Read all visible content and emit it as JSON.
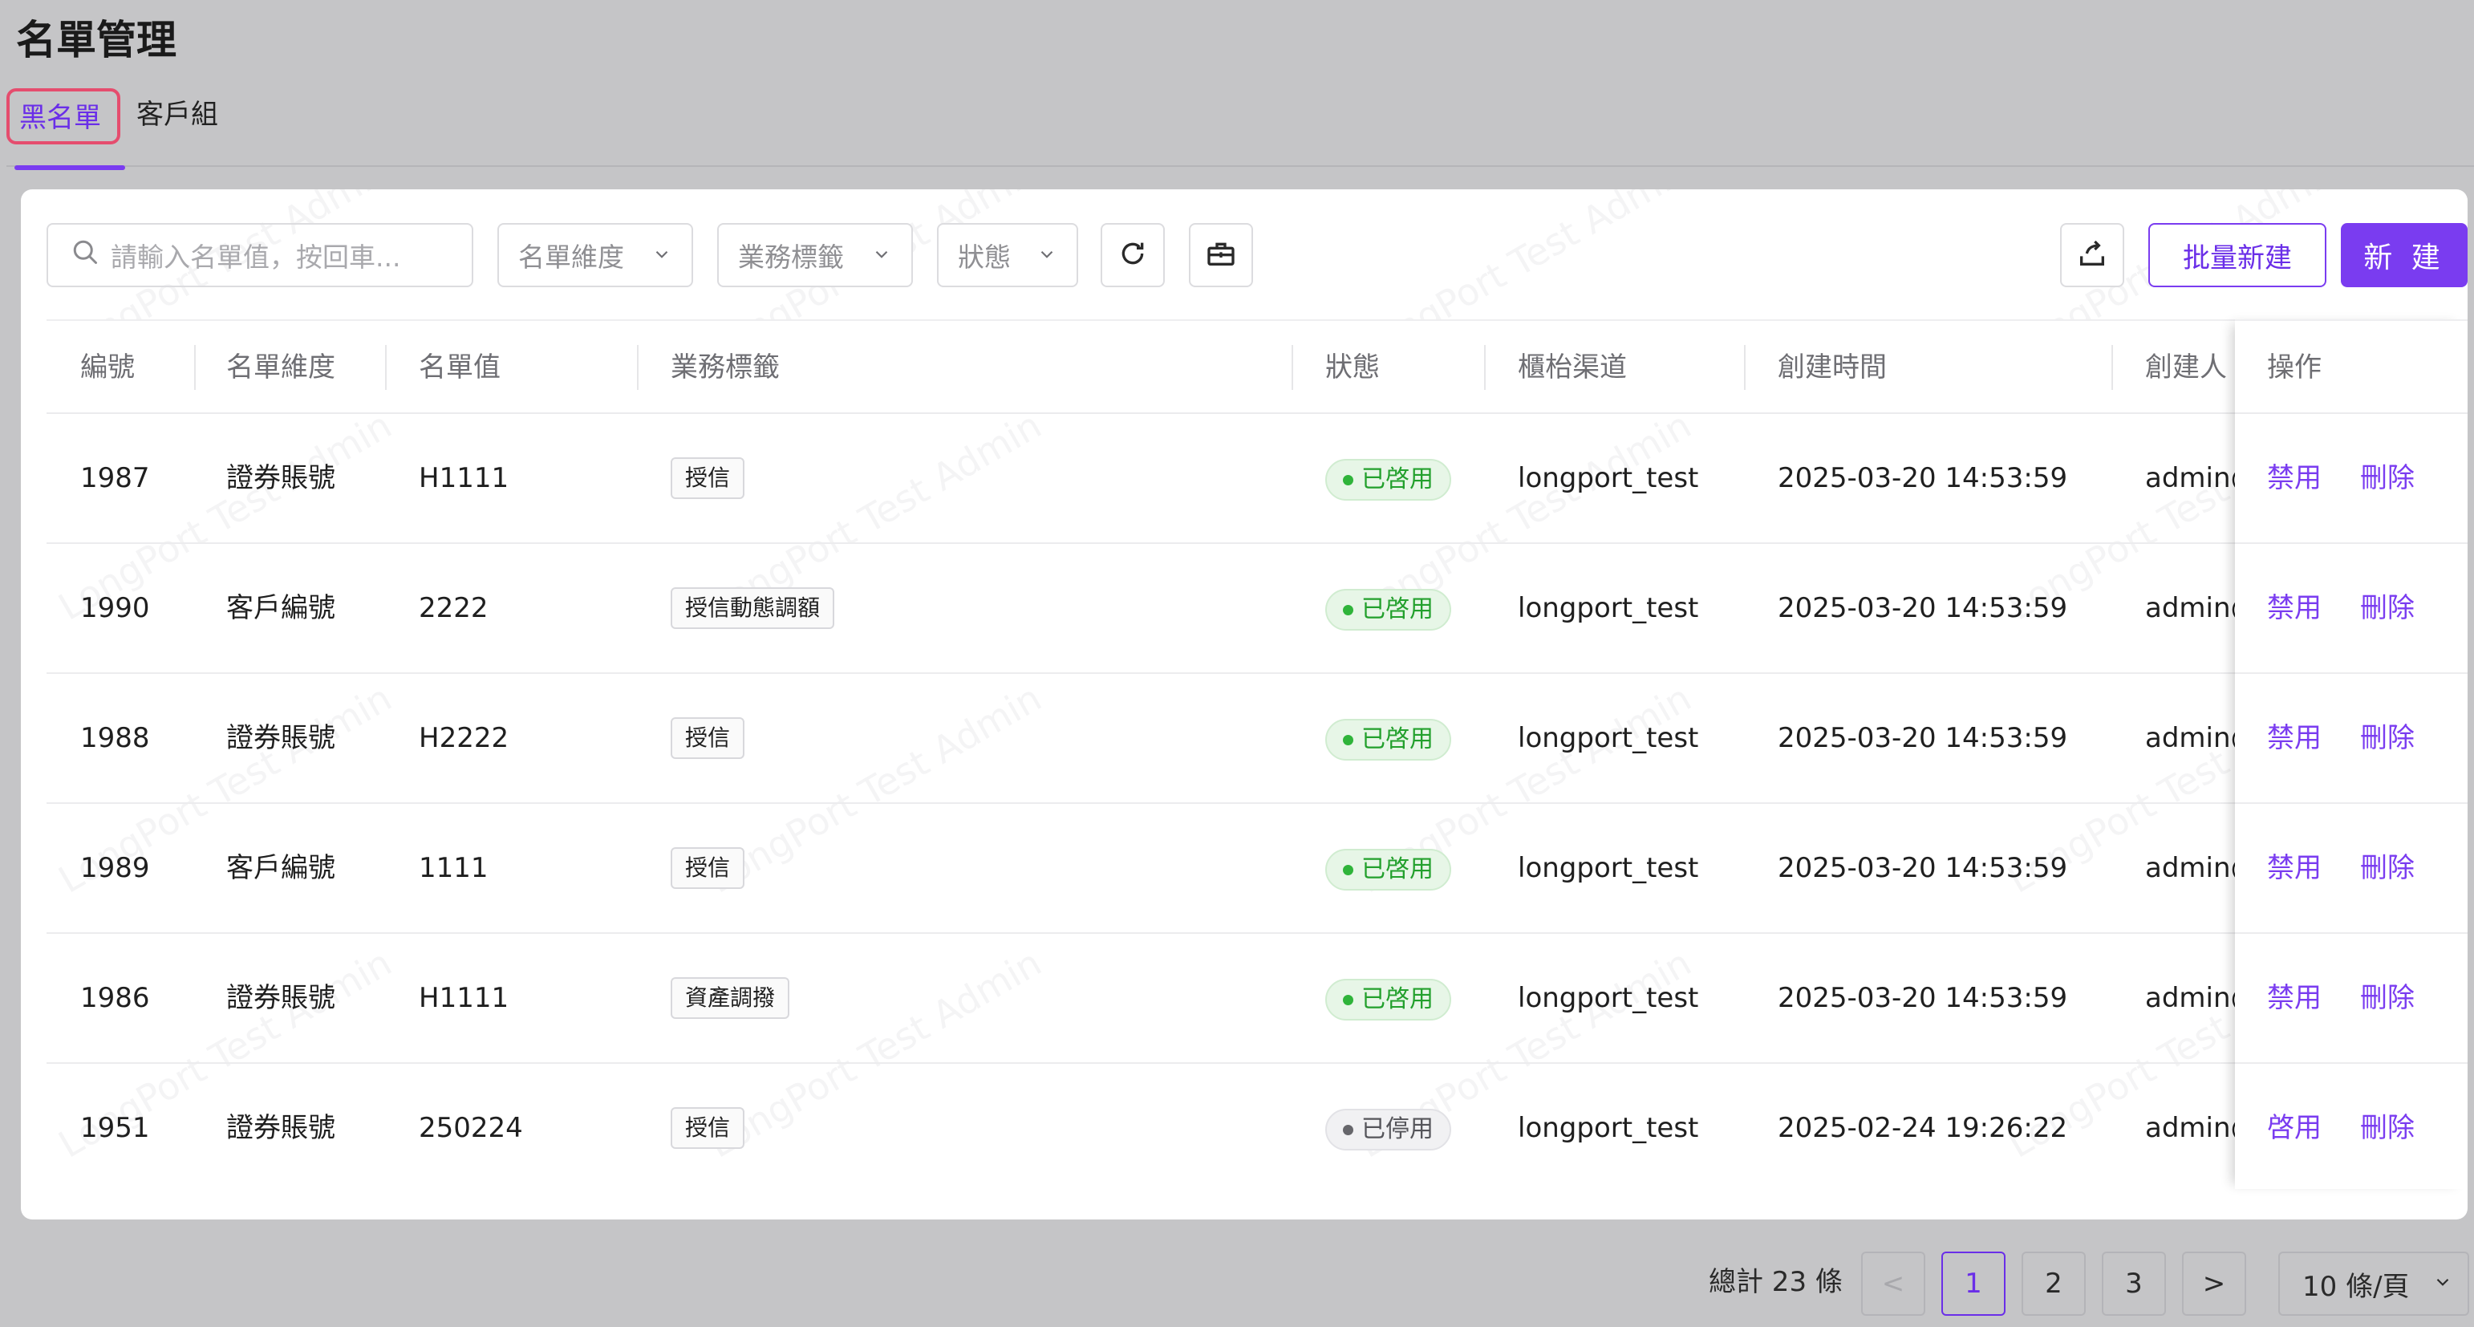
{
  "page_title": "名單管理",
  "tabs": [
    {
      "label": "黑名單",
      "active": true
    },
    {
      "label": "客戶組",
      "active": false
    }
  ],
  "toolbar": {
    "search_placeholder": "請輸入名單值，按回車...",
    "filters": [
      {
        "label": "名單維度"
      },
      {
        "label": "業務標籤"
      },
      {
        "label": "狀態"
      }
    ],
    "refresh_icon": "refresh-icon",
    "toolbox_icon": "toolbox-icon",
    "export_icon": "export-icon",
    "batch_create_label": "批量新建",
    "create_label": "新 建"
  },
  "table": {
    "columns": [
      "編號",
      "名單維度",
      "名單值",
      "業務標籤",
      "狀態",
      "櫃枱渠道",
      "創建時間",
      "創建人",
      "操作"
    ],
    "rows": [
      {
        "id": "1987",
        "dimension": "證券賬號",
        "value": "H1111",
        "tag": "授信",
        "status": "已啓用",
        "status_type": "enabled",
        "channel": "longport_test",
        "created_at": "2025-03-20 14:53:59",
        "creator": "admin@l",
        "action_toggle": "禁用",
        "action_delete": "刪除"
      },
      {
        "id": "1990",
        "dimension": "客戶編號",
        "value": "2222",
        "tag": "授信動態調額",
        "status": "已啓用",
        "status_type": "enabled",
        "channel": "longport_test",
        "created_at": "2025-03-20 14:53:59",
        "creator": "admin@l",
        "action_toggle": "禁用",
        "action_delete": "刪除"
      },
      {
        "id": "1988",
        "dimension": "證券賬號",
        "value": "H2222",
        "tag": "授信",
        "status": "已啓用",
        "status_type": "enabled",
        "channel": "longport_test",
        "created_at": "2025-03-20 14:53:59",
        "creator": "admin@l",
        "action_toggle": "禁用",
        "action_delete": "刪除"
      },
      {
        "id": "1989",
        "dimension": "客戶編號",
        "value": "1111",
        "tag": "授信",
        "status": "已啓用",
        "status_type": "enabled",
        "channel": "longport_test",
        "created_at": "2025-03-20 14:53:59",
        "creator": "admin@l",
        "action_toggle": "禁用",
        "action_delete": "刪除"
      },
      {
        "id": "1986",
        "dimension": "證券賬號",
        "value": "H1111",
        "tag": "資產調撥",
        "status": "已啓用",
        "status_type": "enabled",
        "channel": "longport_test",
        "created_at": "2025-03-20 14:53:59",
        "creator": "admin@l",
        "action_toggle": "禁用",
        "action_delete": "刪除"
      },
      {
        "id": "1951",
        "dimension": "證券賬號",
        "value": "250224",
        "tag": "授信",
        "status": "已停用",
        "status_type": "stopped",
        "channel": "longport_test",
        "created_at": "2025-02-24 19:26:22",
        "creator": "admin@l",
        "action_toggle": "啓用",
        "action_delete": "刪除"
      }
    ]
  },
  "pagination": {
    "total_label": "總計 23 條",
    "prev": "<",
    "pages": [
      "1",
      "2",
      "3"
    ],
    "current_page": "1",
    "next": ">",
    "page_size": "10 條/頁"
  },
  "watermark_text": "LongPort Test Admin",
  "colors": {
    "accent": "#7a3cf0",
    "enabled": "#23a02d",
    "stopped": "#55555a"
  }
}
